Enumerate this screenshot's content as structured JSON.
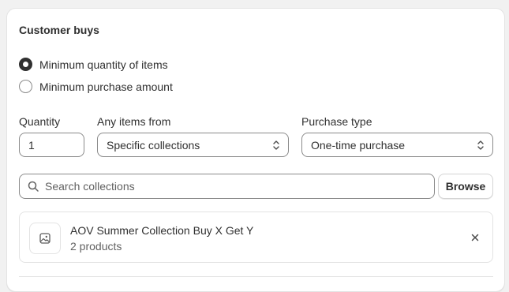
{
  "card": {
    "title": "Customer buys"
  },
  "requirement": {
    "options": [
      {
        "label": "Minimum quantity of items",
        "checked": true
      },
      {
        "label": "Minimum purchase amount",
        "checked": false
      }
    ]
  },
  "quantity": {
    "label": "Quantity",
    "value": "1"
  },
  "items_from": {
    "label": "Any items from",
    "value": "Specific collections"
  },
  "purchase_type": {
    "label": "Purchase type",
    "value": "One-time purchase"
  },
  "search": {
    "placeholder": "Search collections",
    "browse_label": "Browse"
  },
  "selected_collection": {
    "title": "AOV Summer Collection Buy X Get Y",
    "subtitle": "2 products"
  },
  "colors": {
    "text": "#303030",
    "muted": "#616161",
    "border": "#8a8a8a",
    "card_border": "#e3e3e3",
    "background": "#f1f1f1"
  }
}
